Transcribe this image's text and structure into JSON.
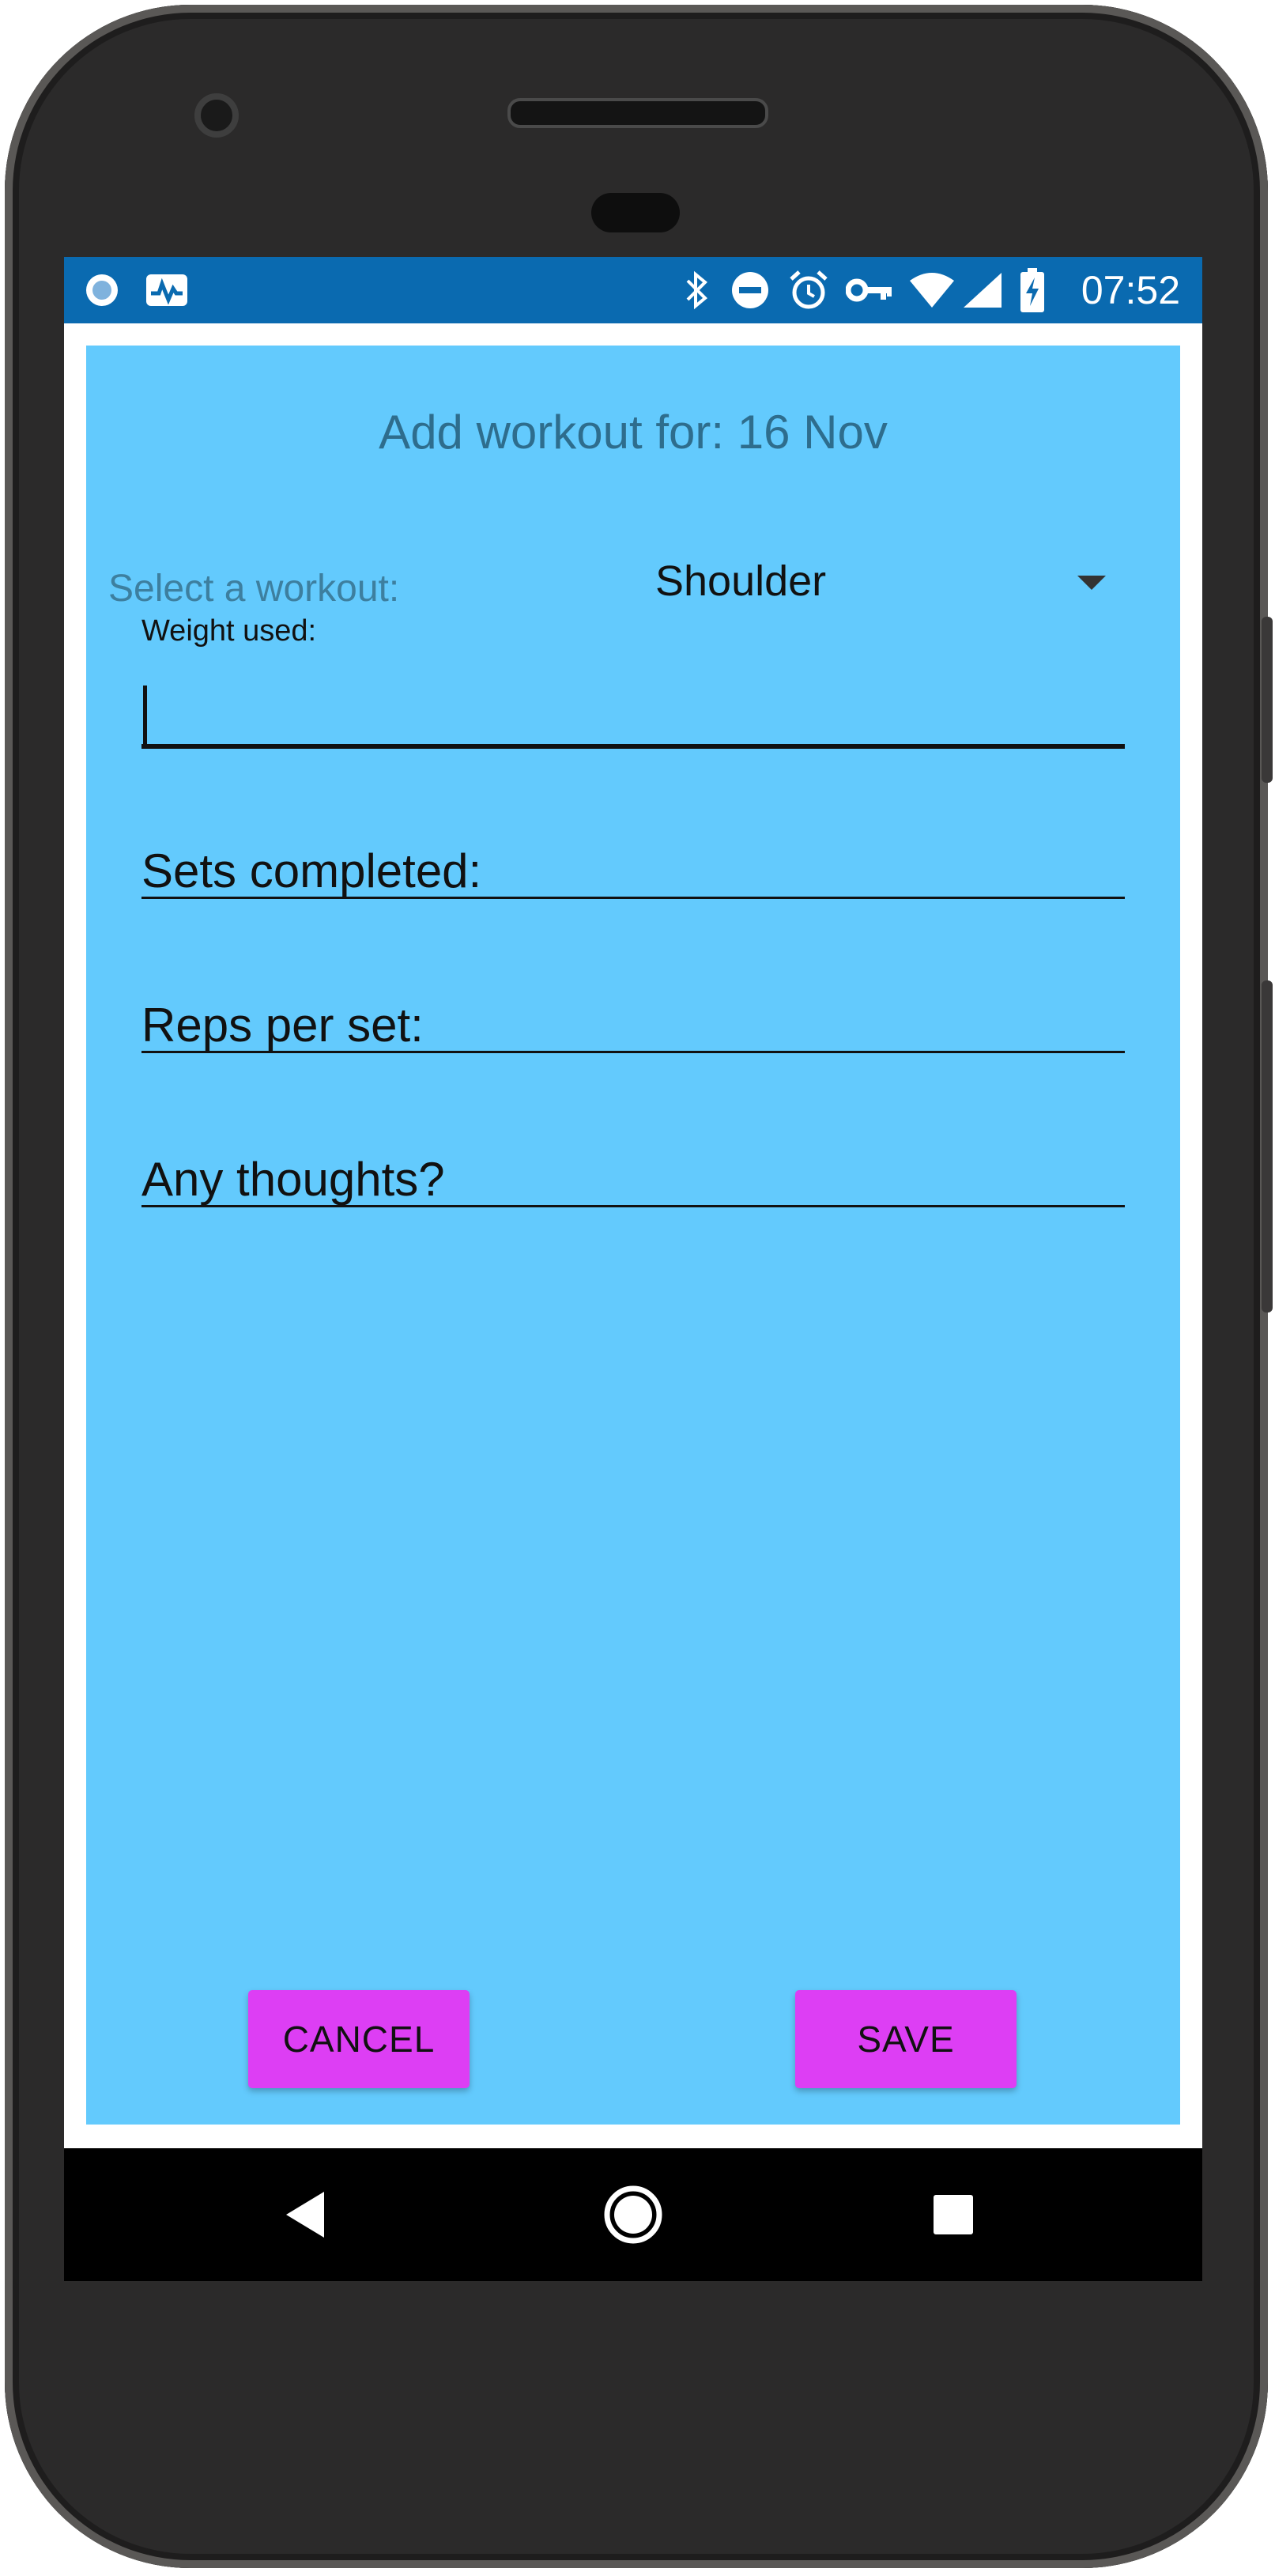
{
  "status_bar": {
    "time": "07:52",
    "left_icons": [
      "record-icon",
      "pulse-icon"
    ],
    "right_icons": [
      "bluetooth-icon",
      "dnd-icon",
      "alarm-icon",
      "vpn-key-icon",
      "wifi-icon",
      "signal-icon",
      "battery-charging-icon"
    ]
  },
  "form": {
    "title": "Add workout for: 16 Nov",
    "select_label": "Select a workout:",
    "workout_selected": "Shoulder",
    "weight_label": "Weight used:",
    "weight_value": "",
    "sets_placeholder": "Sets completed:",
    "reps_placeholder": "Reps per set:",
    "thoughts_placeholder": "Any thoughts?"
  },
  "buttons": {
    "cancel": "CANCEL",
    "save": "SAVE"
  },
  "navigation": {
    "icons": [
      "back-icon",
      "home-icon",
      "recents-icon"
    ]
  },
  "colors": {
    "status_bar": "#0a6ab0",
    "background": "#63cafd",
    "button": "#dd3ef4"
  }
}
